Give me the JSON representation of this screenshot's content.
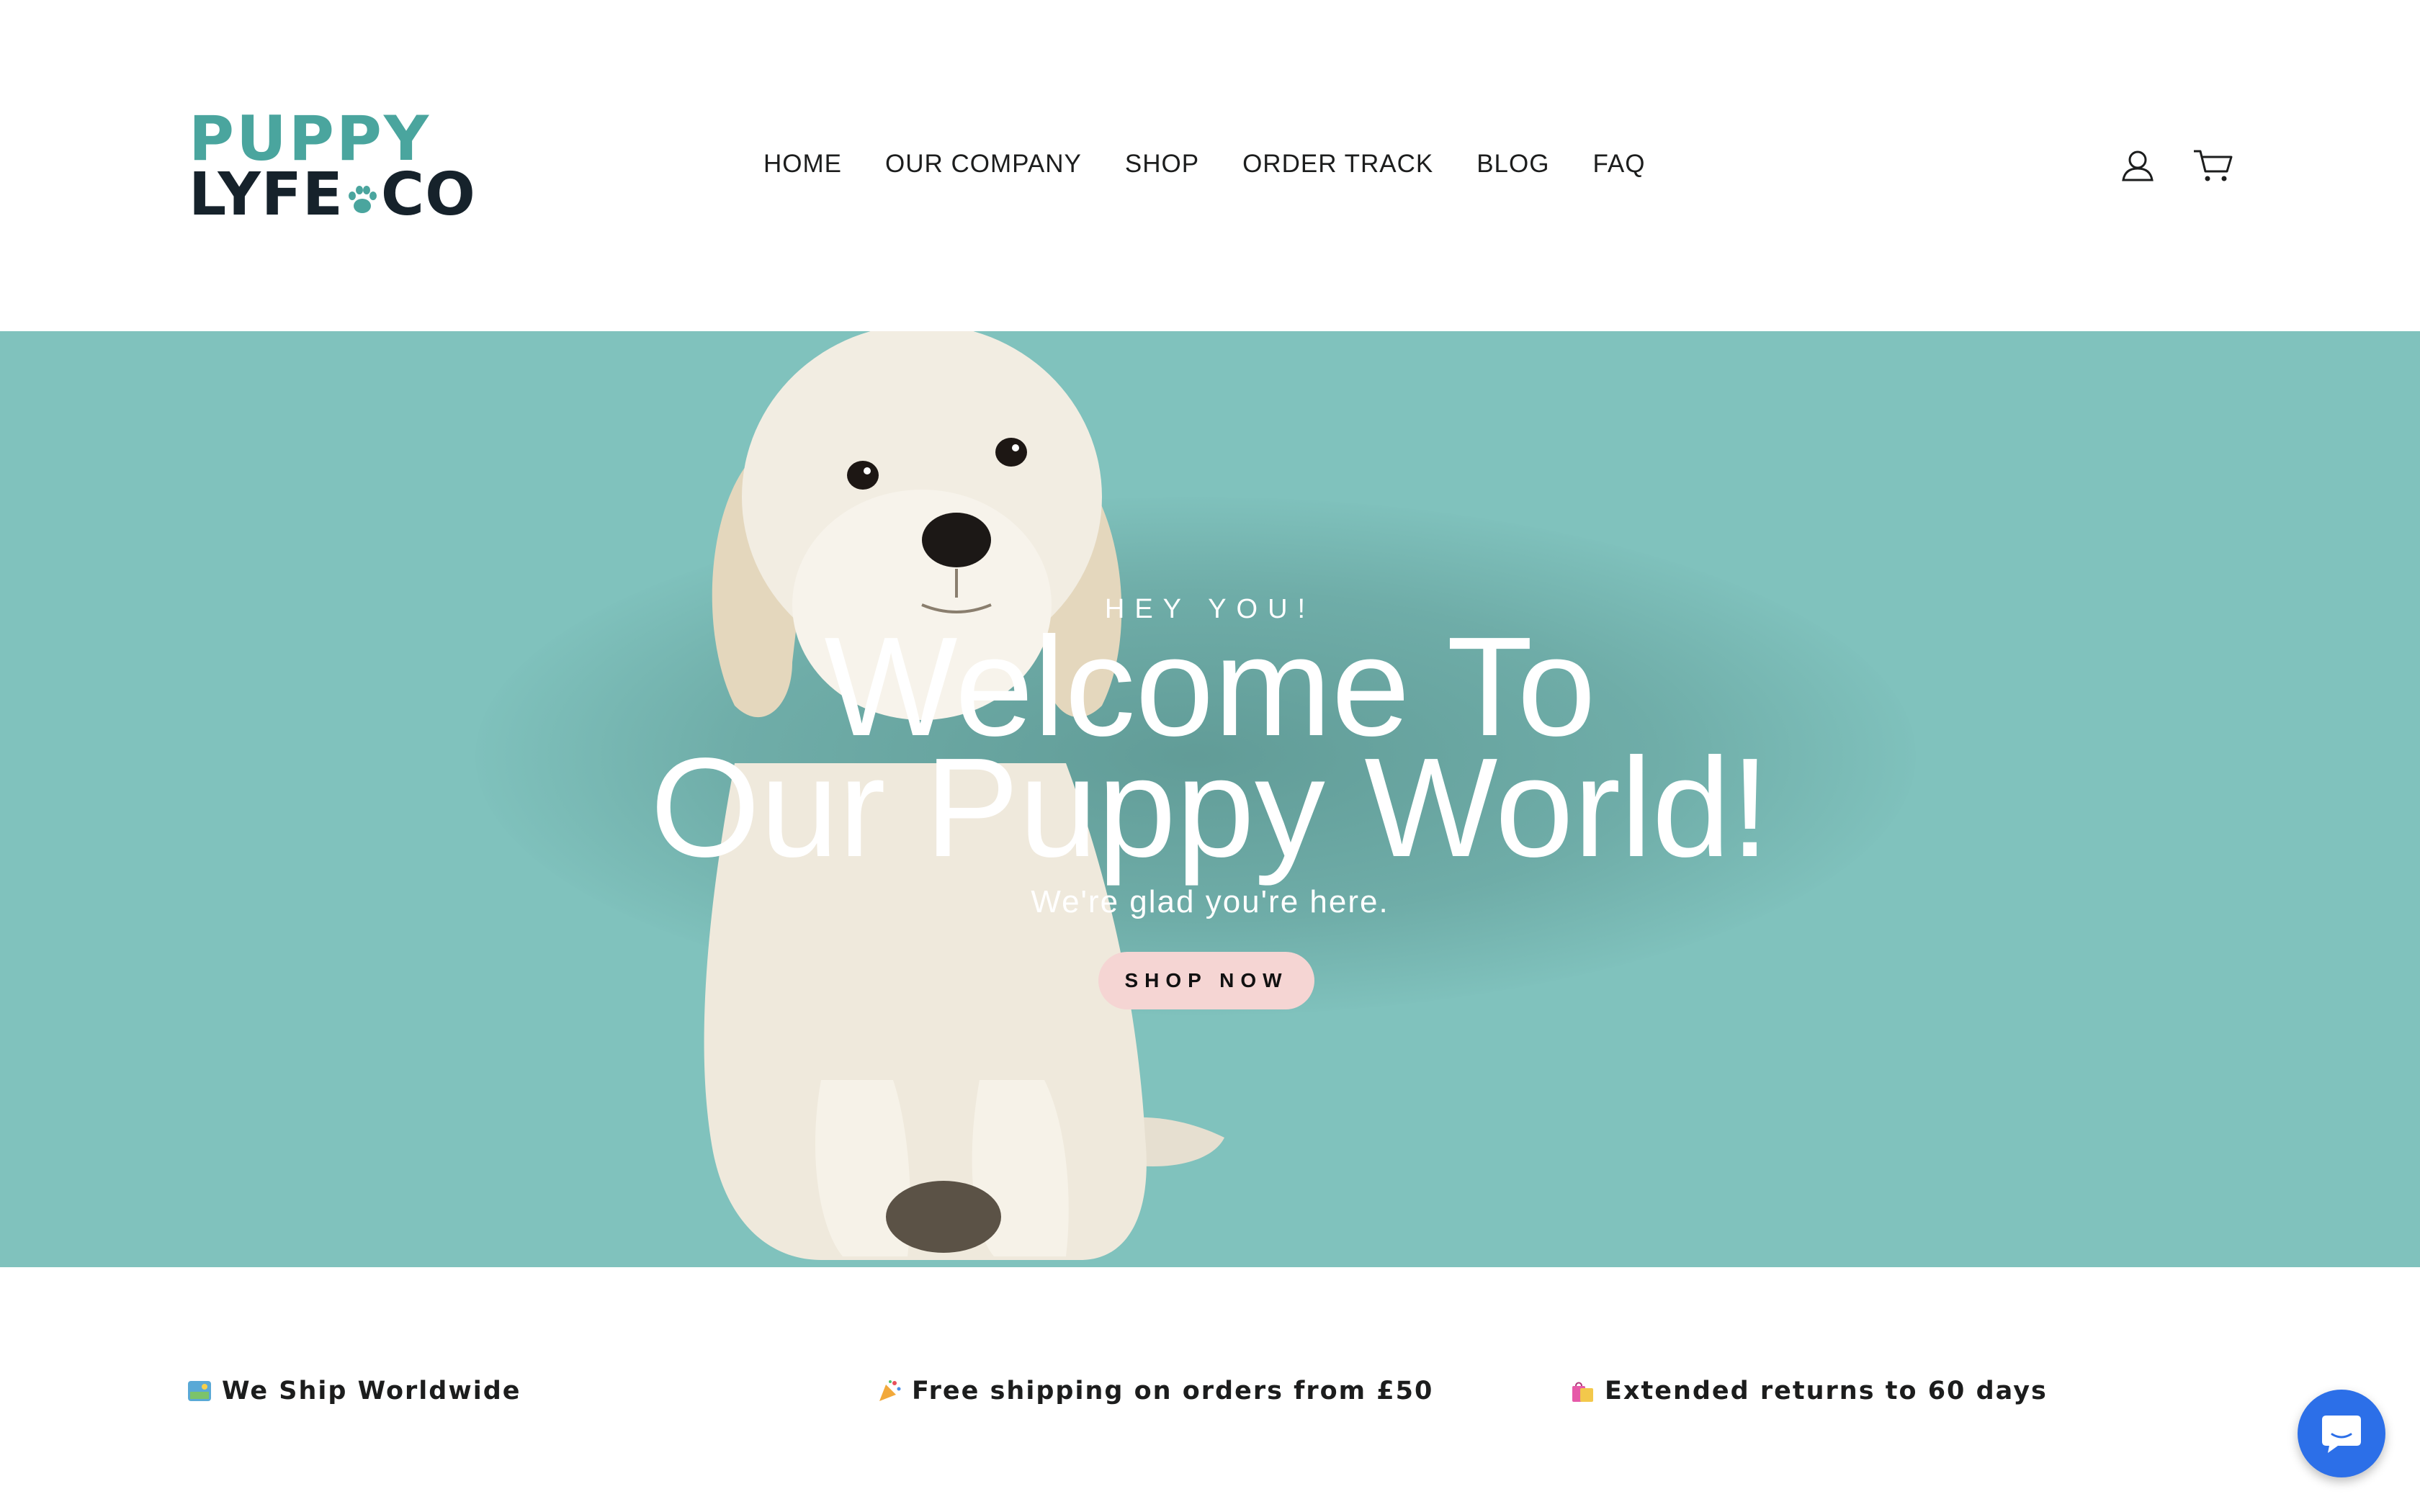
{
  "logo": {
    "line1": "PUPPY",
    "line2_left": "LYFE",
    "line2_right": "CO",
    "colors": {
      "teal": "#4aa59e",
      "dark": "#16222b"
    }
  },
  "nav": {
    "items": [
      "HOME",
      "OUR COMPANY",
      "SHOP",
      "ORDER TRACK",
      "BLOG",
      "FAQ"
    ]
  },
  "header_icons": {
    "account": "account-icon",
    "cart": "cart-icon"
  },
  "hero": {
    "background": "#80c2bd",
    "subtitle": "HEY YOU!",
    "title_line1": "Welcome To",
    "title_line2": "Our Puppy World!",
    "tagline": "We're glad you're here.",
    "button": "SHOP NOW",
    "button_color": "#f5d5d3"
  },
  "features": [
    {
      "icon": "map-icon",
      "text": "We Ship Worldwide"
    },
    {
      "icon": "party-popper-icon",
      "text": "Free shipping on orders from £50"
    },
    {
      "icon": "shopping-bags-icon",
      "text": "Extended returns to 60 days"
    }
  ],
  "chat": {
    "icon": "chat-bubble-icon",
    "color": "#2c6fe8"
  }
}
